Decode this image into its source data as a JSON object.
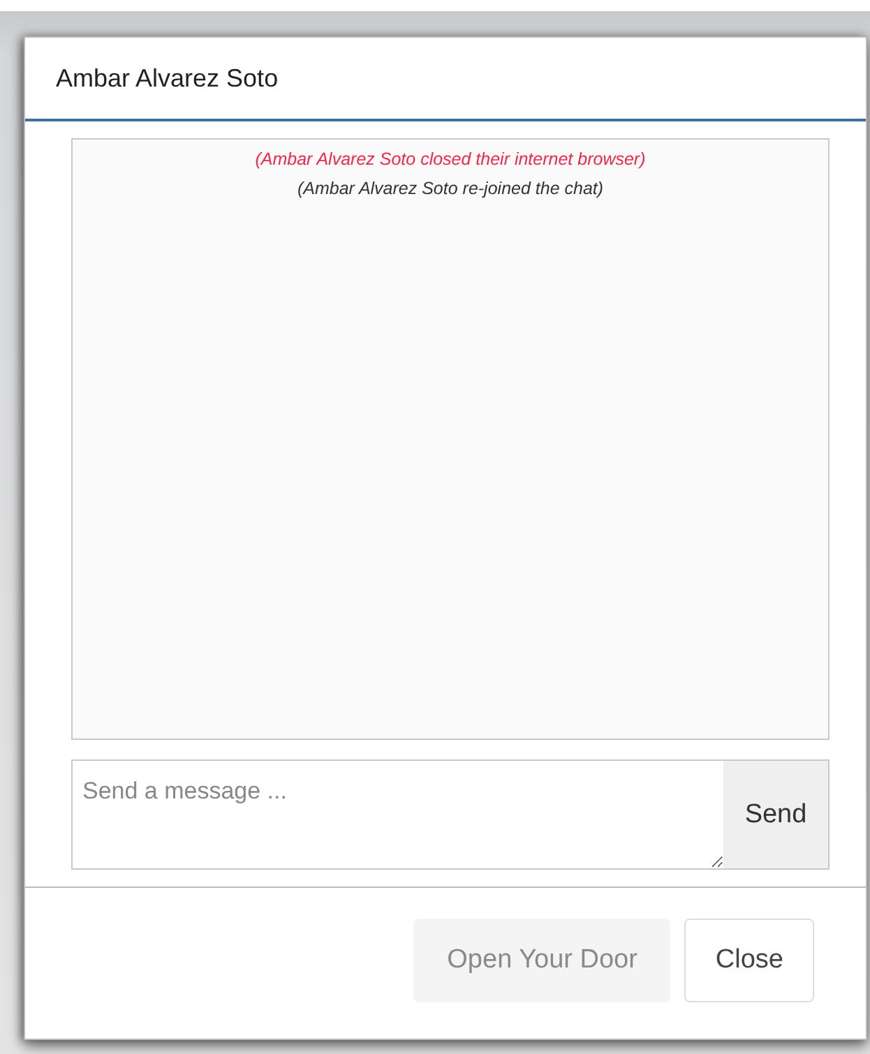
{
  "dialog": {
    "title": "Ambar Alvarez Soto"
  },
  "messages": [
    {
      "kind": "alert",
      "text": "(Ambar Alvarez Soto closed their internet browser)"
    },
    {
      "kind": "info",
      "text": "(Ambar Alvarez Soto re-joined the chat)"
    }
  ],
  "composer": {
    "placeholder": "Send a message ...",
    "send_label": "Send"
  },
  "buttons": [
    {
      "label": "Open Your Door",
      "disabled": true
    },
    {
      "label": "Close",
      "disabled": false
    }
  ]
}
